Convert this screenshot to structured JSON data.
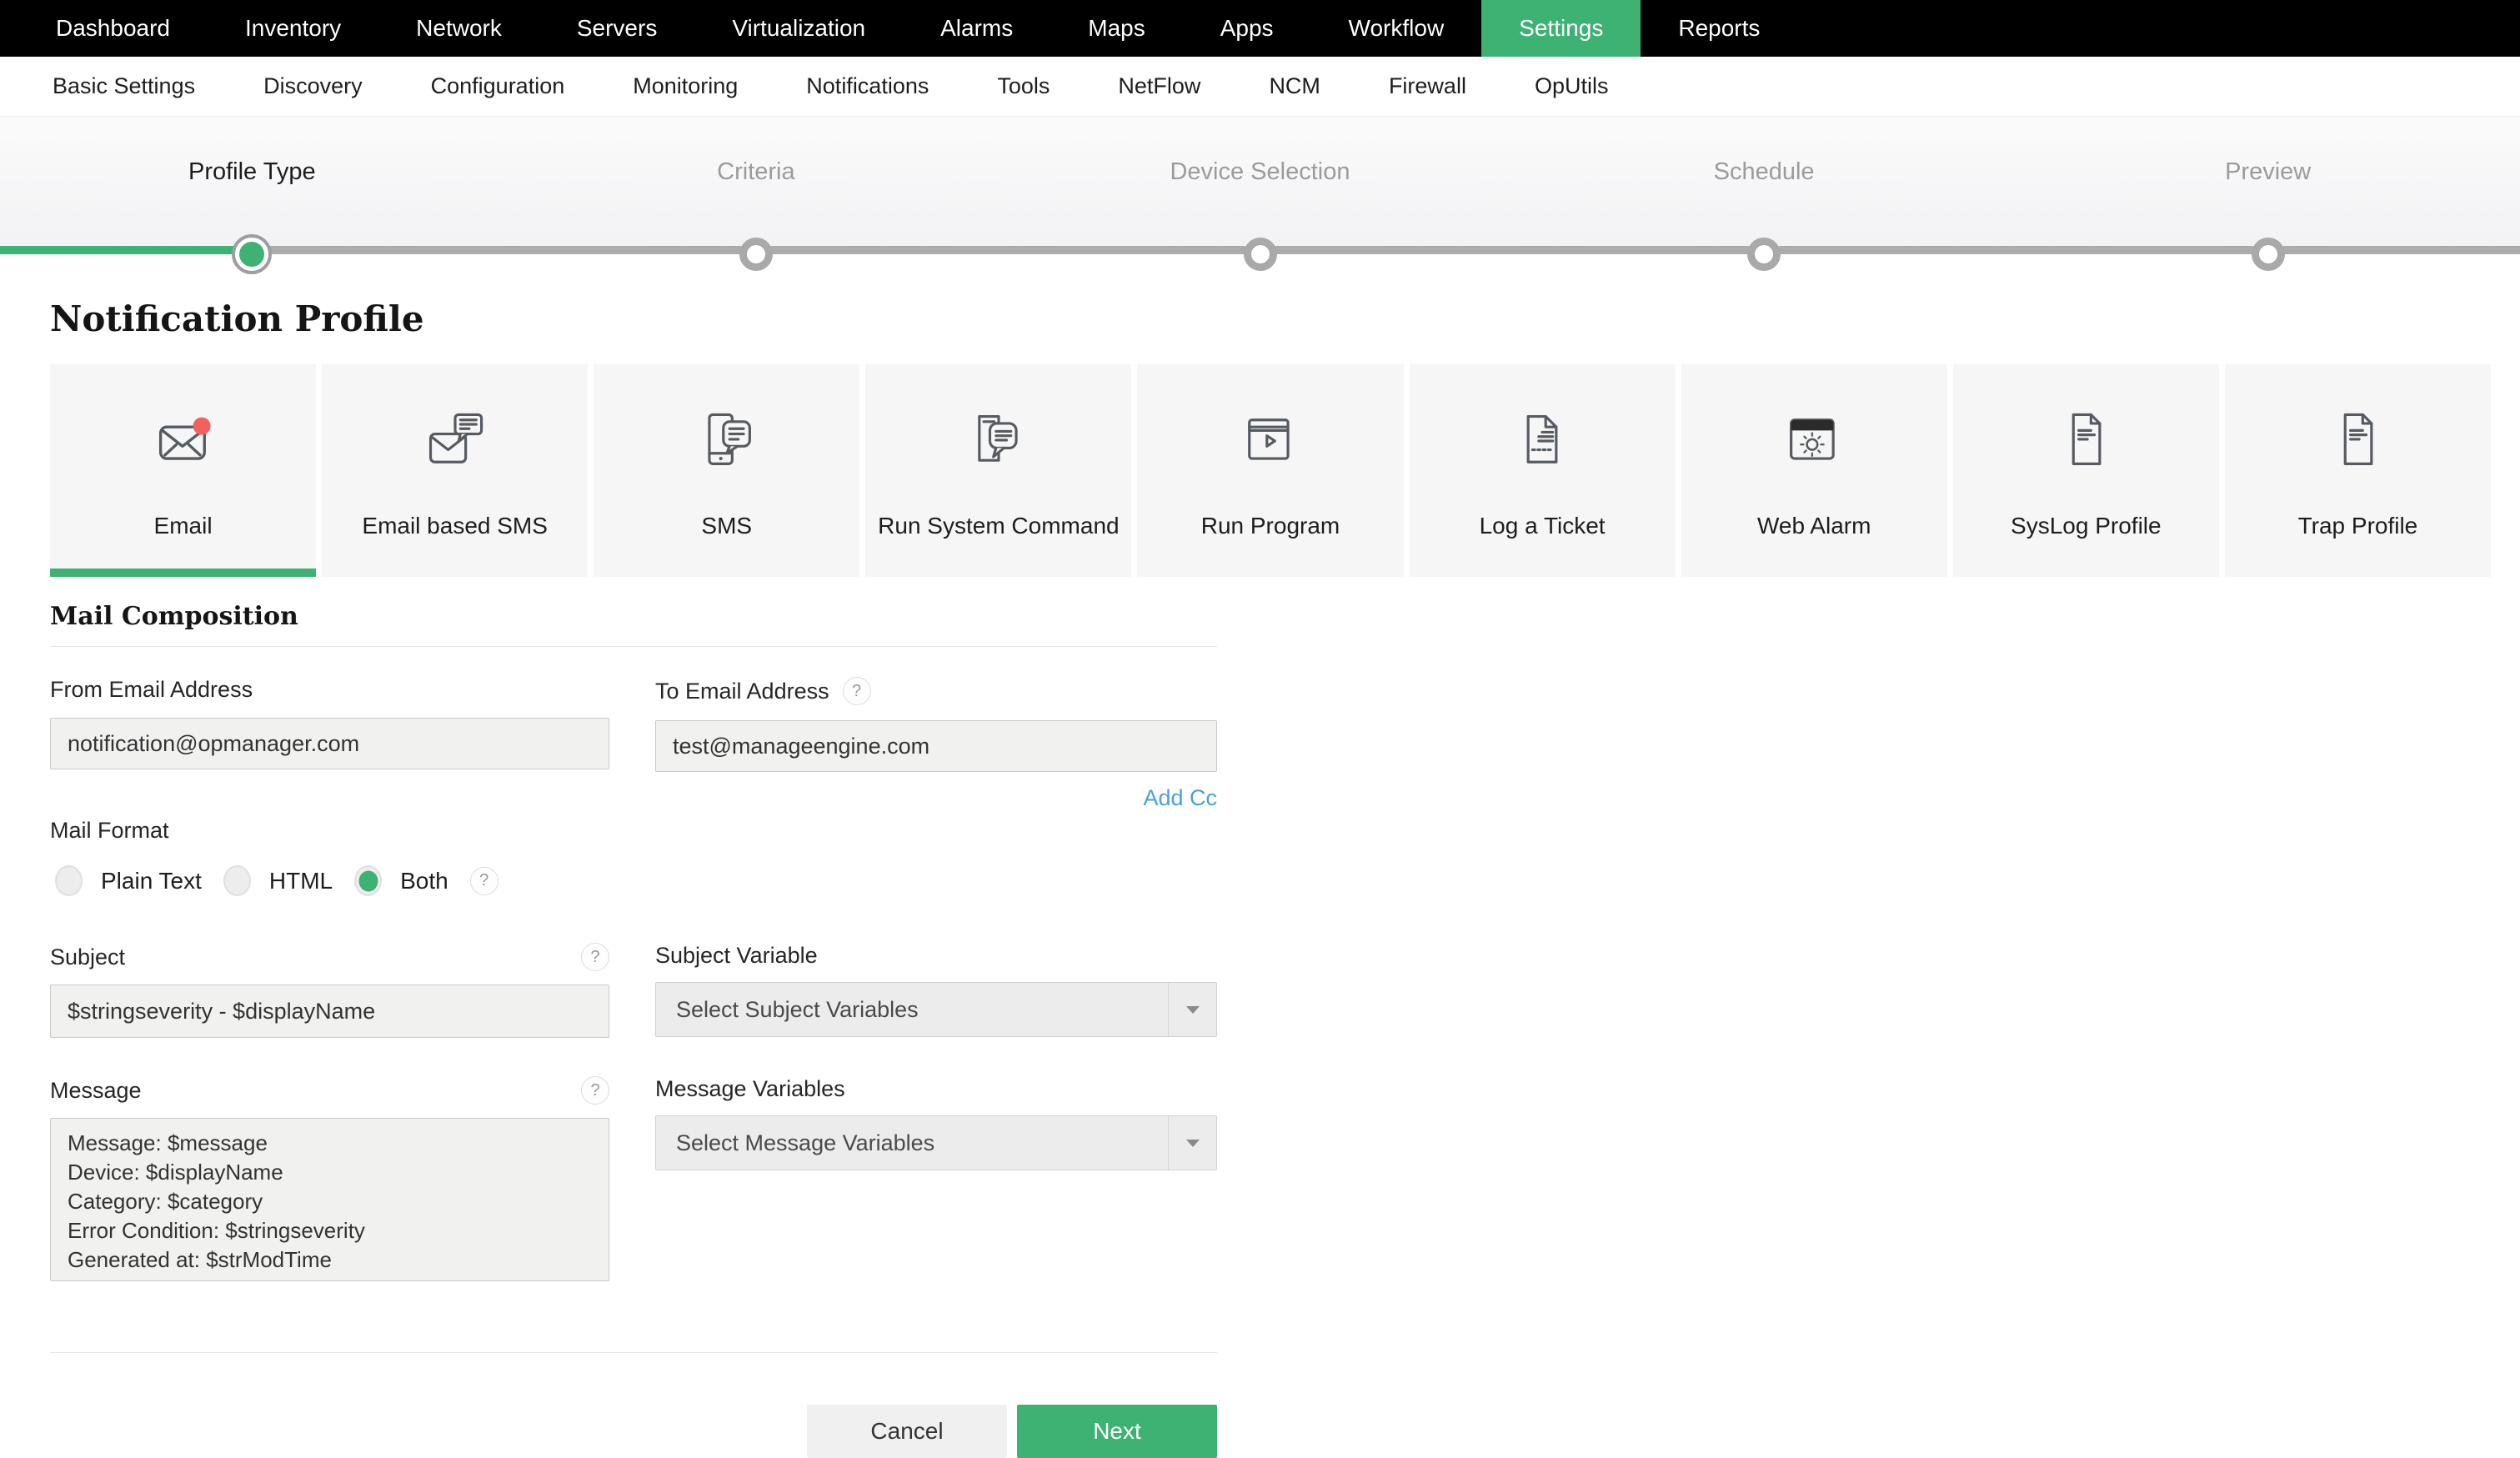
{
  "colors": {
    "accent_green": "#3eb272",
    "topnav_bg": "#000000",
    "badge_red": "#f2615e",
    "link_blue": "#4aa0dc"
  },
  "help_symbol": "?",
  "topnav": {
    "items": [
      {
        "label": "Dashboard",
        "active": false
      },
      {
        "label": "Inventory",
        "active": false
      },
      {
        "label": "Network",
        "active": false
      },
      {
        "label": "Servers",
        "active": false
      },
      {
        "label": "Virtualization",
        "active": false
      },
      {
        "label": "Alarms",
        "active": false
      },
      {
        "label": "Maps",
        "active": false
      },
      {
        "label": "Apps",
        "active": false
      },
      {
        "label": "Workflow",
        "active": false
      },
      {
        "label": "Settings",
        "active": true
      },
      {
        "label": "Reports",
        "active": false
      }
    ]
  },
  "subnav": {
    "items": [
      {
        "label": "Basic Settings"
      },
      {
        "label": "Discovery"
      },
      {
        "label": "Configuration"
      },
      {
        "label": "Monitoring"
      },
      {
        "label": "Notifications"
      },
      {
        "label": "Tools"
      },
      {
        "label": "NetFlow"
      },
      {
        "label": "NCM"
      },
      {
        "label": "Firewall"
      },
      {
        "label": "OpUtils"
      }
    ]
  },
  "stepper": {
    "steps": [
      {
        "label": "Profile Type",
        "state": "active"
      },
      {
        "label": "Criteria",
        "state": "upcoming"
      },
      {
        "label": "Device Selection",
        "state": "upcoming"
      },
      {
        "label": "Schedule",
        "state": "upcoming"
      },
      {
        "label": "Preview",
        "state": "upcoming"
      }
    ]
  },
  "page": {
    "title": "Notification Profile"
  },
  "profile_types": {
    "tiles": [
      {
        "label": "Email",
        "icon": "email-icon",
        "selected": true
      },
      {
        "label": "Email based SMS",
        "icon": "email-sms-icon",
        "selected": false
      },
      {
        "label": "SMS",
        "icon": "sms-icon",
        "selected": false
      },
      {
        "label": "Run System Command",
        "icon": "run-system-command-icon",
        "selected": false
      },
      {
        "label": "Run Program",
        "icon": "run-program-icon",
        "selected": false
      },
      {
        "label": "Log a Ticket",
        "icon": "log-ticket-icon",
        "selected": false
      },
      {
        "label": "Web Alarm",
        "icon": "web-alarm-icon",
        "selected": false
      },
      {
        "label": "SysLog Profile",
        "icon": "syslog-icon",
        "selected": false
      },
      {
        "label": "Trap Profile",
        "icon": "trap-icon",
        "selected": false
      }
    ]
  },
  "mail_composition": {
    "heading": "Mail Composition",
    "from_email": {
      "label": "From Email Address",
      "value": "notification@opmanager.com"
    },
    "to_email": {
      "label": "To Email Address",
      "value": "test@manageengine.com"
    },
    "add_cc_label": "Add Cc",
    "mail_format": {
      "label": "Mail Format",
      "options": [
        "Plain Text",
        "HTML",
        "Both"
      ],
      "selected": "Both"
    },
    "subject": {
      "label": "Subject",
      "value": "$stringseverity - $displayName"
    },
    "subject_variable": {
      "label": "Subject Variable",
      "placeholder": "Select Subject Variables"
    },
    "message": {
      "label": "Message",
      "value": "Message: $message\nDevice: $displayName\nCategory: $category\nError Condition: $stringseverity\nGenerated at: $strModTime"
    },
    "message_variables": {
      "label": "Message Variables",
      "placeholder": "Select Message Variables"
    }
  },
  "actions": {
    "cancel_label": "Cancel",
    "next_label": "Next"
  }
}
